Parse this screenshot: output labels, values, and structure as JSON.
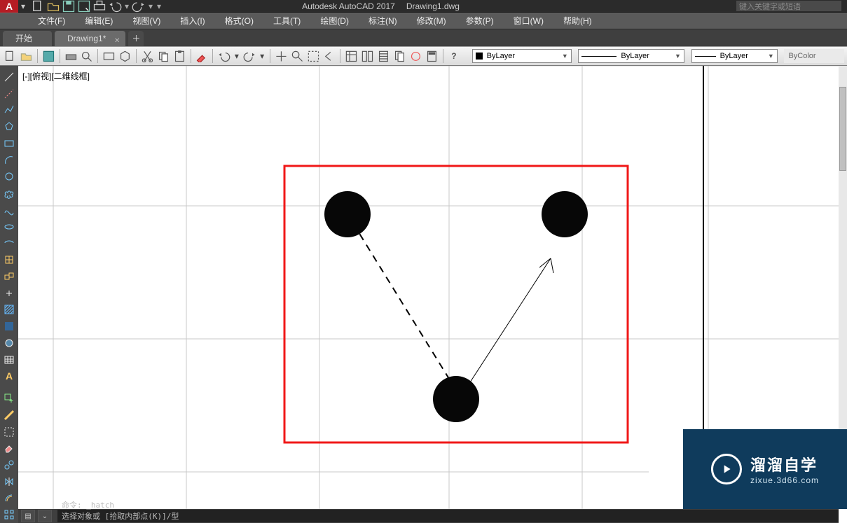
{
  "titlebar": {
    "app_name": "Autodesk AutoCAD 2017",
    "file_name": "Drawing1.dwg",
    "search_placeholder": "键入关键字或短语",
    "logo_letter": "A"
  },
  "menu": {
    "items": [
      "文件(F)",
      "编辑(E)",
      "视图(V)",
      "插入(I)",
      "格式(O)",
      "工具(T)",
      "绘图(D)",
      "标注(N)",
      "修改(M)",
      "参数(P)",
      "窗口(W)",
      "帮助(H)"
    ]
  },
  "tabs": {
    "start": "开始",
    "doc": "Drawing1*"
  },
  "toolbar": {
    "layer_combo1": "ByLayer",
    "layer_combo2": "ByLayer",
    "layer_combo3": "ByLayer",
    "color_combo": "ByColor"
  },
  "viewport_label": "[-][俯视][二维线框]",
  "watermark": {
    "title": "溜溜自学",
    "sub": "zixue.3d66.com"
  },
  "command": {
    "line1": "命令:  _hatch",
    "line2": "选择对象或 [拾取内部点(K)]/型"
  },
  "qat_icons": [
    "new-icon",
    "open-icon",
    "save-icon",
    "saveas-icon",
    "plot-icon",
    "undo-icon",
    "redo-icon",
    "dropdown-icon"
  ],
  "toolbar_icons": [
    "new-icon",
    "open-icon",
    "save-icon",
    "plot-icon",
    "preview-icon",
    "publish-icon",
    "cut-icon",
    "copy-icon",
    "paste-icon",
    "match-icon",
    "undo-icon",
    "redo-icon",
    "pan-icon",
    "zoom-icon",
    "zoom-extents-icon",
    "properties-icon",
    "design-center-icon",
    "tool-palettes-icon",
    "sheet-set-icon",
    "markup-icon",
    "calc-icon",
    "help-icon"
  ],
  "left_tool_icons": [
    "line-icon",
    "construction-line-icon",
    "polyline-icon",
    "polygon-icon",
    "rectangle-icon",
    "arc-icon",
    "circle-icon",
    "revision-cloud-icon",
    "spline-icon",
    "ellipse-icon",
    "ellipse-arc-icon",
    "insert-block-icon",
    "make-block-icon",
    "point-icon",
    "hatch-icon",
    "gradient-icon",
    "region-icon",
    "table-icon",
    "text-icon",
    "addselected-icon",
    "measure-icon",
    "selectall-icon",
    "erase-icon",
    "copy-icon",
    "mirror-icon",
    "offset-icon",
    "array-icon"
  ]
}
